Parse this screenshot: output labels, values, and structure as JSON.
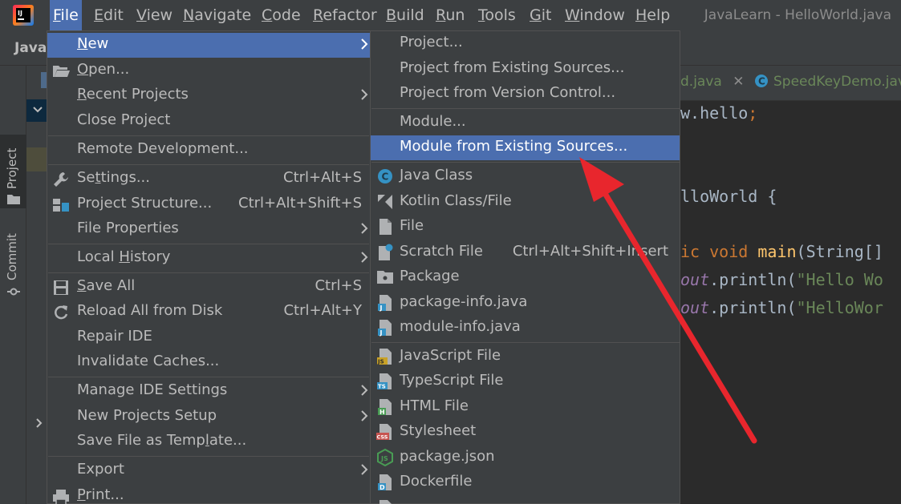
{
  "window": {
    "title": "JavaLearn - HelloWorld.java"
  },
  "menubar": {
    "items": [
      {
        "mnemonic": "F",
        "rest": "ile"
      },
      {
        "mnemonic": "E",
        "rest": "dit"
      },
      {
        "mnemonic": "V",
        "rest": "iew"
      },
      {
        "mnemonic": "N",
        "rest": "avigate"
      },
      {
        "mnemonic": "C",
        "rest": "ode"
      },
      {
        "mnemonic": "R",
        "rest": "efactor"
      },
      {
        "mnemonic": "B",
        "rest": "uild"
      },
      {
        "mnemonic": "R",
        "rest": "un"
      },
      {
        "mnemonic": "T",
        "rest": "ools"
      },
      {
        "mnemonic": "G",
        "rest": "it"
      },
      {
        "mnemonic": "W",
        "rest": "indow"
      },
      {
        "mnemonic": "H",
        "rest": "elp"
      }
    ]
  },
  "navbar": {
    "project": "Java"
  },
  "left_strip": {
    "project_tab": "Project",
    "commit_tab": "Commit"
  },
  "editor": {
    "tabs": [
      {
        "label": "d.java"
      },
      {
        "label": "SpeedKeyDemo.java"
      }
    ],
    "code": [
      "w.hello;",
      "lloWorld {",
      "ic void main(String[]",
      "out.println(\"Hello Wo",
      "out.println(\"HelloWor"
    ]
  },
  "file_menu": {
    "items": [
      {
        "label_pre": "",
        "mnemonic": "N",
        "label_post": "ew",
        "shortcut": "",
        "submenu": true
      },
      {
        "label_pre": "",
        "mnemonic": "O",
        "label_post": "pen...",
        "shortcut": "",
        "submenu": false
      },
      {
        "label_pre": "",
        "mnemonic": "R",
        "label_post": "ecent Projects",
        "shortcut": "",
        "submenu": true
      },
      {
        "label_pre": "Close Project",
        "mnemonic": "",
        "label_post": "",
        "shortcut": "",
        "submenu": false
      },
      {
        "label_pre": "Remote Development...",
        "mnemonic": "",
        "label_post": "",
        "shortcut": "",
        "submenu": false
      },
      {
        "label_pre": "Se",
        "mnemonic": "t",
        "label_post": "tings...",
        "shortcut": "Ctrl+Alt+S",
        "submenu": false
      },
      {
        "label_pre": "Project Structure...",
        "mnemonic": "",
        "label_post": "",
        "shortcut": "Ctrl+Alt+Shift+S",
        "submenu": false
      },
      {
        "label_pre": "File Properties",
        "mnemonic": "",
        "label_post": "",
        "shortcut": "",
        "submenu": true
      },
      {
        "label_pre": "Local ",
        "mnemonic": "H",
        "label_post": "istory",
        "shortcut": "",
        "submenu": true
      },
      {
        "label_pre": "",
        "mnemonic": "S",
        "label_post": "ave All",
        "shortcut": "Ctrl+S",
        "submenu": false
      },
      {
        "label_pre": "Reload All from Disk",
        "mnemonic": "",
        "label_post": "",
        "shortcut": "Ctrl+Alt+Y",
        "submenu": false
      },
      {
        "label_pre": "Repair IDE",
        "mnemonic": "",
        "label_post": "",
        "shortcut": "",
        "submenu": false
      },
      {
        "label_pre": "Invalidate Caches...",
        "mnemonic": "",
        "label_post": "",
        "shortcut": "",
        "submenu": false
      },
      {
        "label_pre": "Manage IDE Settings",
        "mnemonic": "",
        "label_post": "",
        "shortcut": "",
        "submenu": true
      },
      {
        "label_pre": "New Projects Setup",
        "mnemonic": "",
        "label_post": "",
        "shortcut": "",
        "submenu": true
      },
      {
        "label_pre": "Save File as Temp",
        "mnemonic": "l",
        "label_post": "ate...",
        "shortcut": "",
        "submenu": false
      },
      {
        "label_pre": "Export",
        "mnemonic": "",
        "label_post": "",
        "shortcut": "",
        "submenu": true
      },
      {
        "label_pre": "",
        "mnemonic": "P",
        "label_post": "rint...",
        "shortcut": "",
        "submenu": false
      }
    ]
  },
  "new_menu": {
    "items": [
      {
        "label": "Project...",
        "shortcut": "",
        "icon": ""
      },
      {
        "label": "Project from Existing Sources...",
        "shortcut": "",
        "icon": ""
      },
      {
        "label": "Project from Version Control...",
        "shortcut": "",
        "icon": ""
      },
      {
        "label": "Module...",
        "shortcut": "",
        "icon": ""
      },
      {
        "label": "Module from Existing Sources...",
        "shortcut": "",
        "icon": ""
      },
      {
        "label": "Java Class",
        "shortcut": "",
        "icon": "java-class-icon"
      },
      {
        "label": "Kotlin Class/File",
        "shortcut": "",
        "icon": "kotlin-icon"
      },
      {
        "label": "File",
        "shortcut": "",
        "icon": "file-icon"
      },
      {
        "label": "Scratch File",
        "shortcut": "Ctrl+Alt+Shift+Insert",
        "icon": "scratch-file-icon"
      },
      {
        "label": "Package",
        "shortcut": "",
        "icon": "package-icon"
      },
      {
        "label": "package-info.java",
        "shortcut": "",
        "icon": "java-file-icon"
      },
      {
        "label": "module-info.java",
        "shortcut": "",
        "icon": "java-file-icon"
      },
      {
        "label": "JavaScript File",
        "shortcut": "",
        "icon": "javascript-file-icon"
      },
      {
        "label": "TypeScript File",
        "shortcut": "",
        "icon": "typescript-file-icon"
      },
      {
        "label": "HTML File",
        "shortcut": "",
        "icon": "html-file-icon"
      },
      {
        "label": "Stylesheet",
        "shortcut": "",
        "icon": "css-file-icon"
      },
      {
        "label": "package.json",
        "shortcut": "",
        "icon": "nodejs-icon"
      },
      {
        "label": "Dockerfile",
        "shortcut": "",
        "icon": "docker-file-icon"
      }
    ]
  },
  "colors": {
    "menu_bg": "#3c3f41",
    "selection": "#4b6eaf",
    "editor_bg": "#2b2b2b",
    "annotation_arrow": "#e8262d"
  }
}
